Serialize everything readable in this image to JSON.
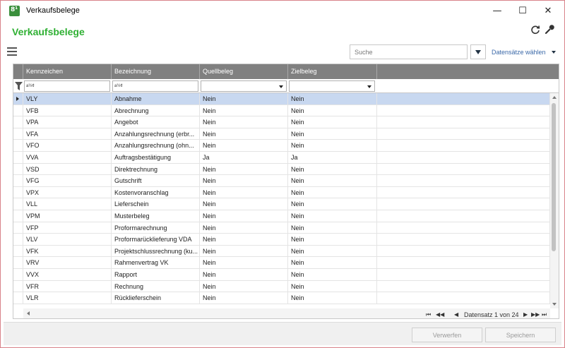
{
  "window": {
    "title": "Verkaufsbelege",
    "min_glyph": "—",
    "max_glyph": "☐",
    "close_glyph": "✕"
  },
  "header": {
    "page_title": "Verkaufsbelege",
    "app_icon_text": "8¹"
  },
  "toolbar": {
    "search_placeholder": "Suche",
    "select_records_label": "Datensätze wählen"
  },
  "grid": {
    "columns": [
      "Kennzeichen",
      "Bezeichnung",
      "Quellbeleg",
      "Zielbeleg"
    ],
    "filter_text_1": "a½¢",
    "filter_text_2": "a½¢",
    "rows": [
      [
        "VLY",
        "Abnahme",
        "Nein",
        "Nein"
      ],
      [
        "VFB",
        "Abrechnung",
        "Nein",
        "Nein"
      ],
      [
        "VPA",
        "Angebot",
        "Nein",
        "Nein"
      ],
      [
        "VFA",
        "Anzahlungsrechnung (erbr...",
        "Nein",
        "Nein"
      ],
      [
        "VFO",
        "Anzahlungsrechnung (ohn...",
        "Nein",
        "Nein"
      ],
      [
        "VVA",
        "Auftragsbestätigung",
        "Ja",
        "Ja"
      ],
      [
        "VSD",
        "Direktrechnung",
        "Nein",
        "Nein"
      ],
      [
        "VFG",
        "Gutschrift",
        "Nein",
        "Nein"
      ],
      [
        "VPX",
        "Kostenvoranschlag",
        "Nein",
        "Nein"
      ],
      [
        "VLL",
        "Lieferschein",
        "Nein",
        "Nein"
      ],
      [
        "VPM",
        "Musterbeleg",
        "Nein",
        "Nein"
      ],
      [
        "VFP",
        "Proformarechnung",
        "Nein",
        "Nein"
      ],
      [
        "VLV",
        "Proformarücklieferung VDA",
        "Nein",
        "Nein"
      ],
      [
        "VFK",
        "Projektschlussrechnung (ku...",
        "Nein",
        "Nein"
      ],
      [
        "VRV",
        "Rahmenvertrag VK",
        "Nein",
        "Nein"
      ],
      [
        "VVX",
        "Rapport",
        "Nein",
        "Nein"
      ],
      [
        "VFR",
        "Rechnung",
        "Nein",
        "Nein"
      ],
      [
        "VLR",
        "Rücklieferschein",
        "Nein",
        "Nein"
      ]
    ]
  },
  "pager": {
    "first": "⏮",
    "prev_page": "◀◀",
    "prev": "◀",
    "text": "Datensatz 1 von 24",
    "next": "▶",
    "next_page": "▶▶",
    "last": "⏭"
  },
  "footer": {
    "discard_label": "Verwerfen",
    "save_label": "Speichern"
  },
  "colors": {
    "title_green": "#2fb033",
    "header_gray": "#808080",
    "selected_row": "#c8d8f0",
    "link_blue": "#3a68a8"
  }
}
